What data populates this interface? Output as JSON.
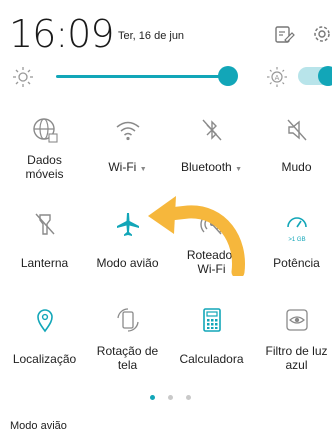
{
  "header": {
    "time": "16:09",
    "date": "Ter, 16 de jun"
  },
  "brightness": {
    "level": 0.94,
    "auto_enabled": true
  },
  "tiles": [
    {
      "label": "Dados\nmóveis",
      "icon": "globe-icon",
      "active": false
    },
    {
      "label": "Wi-Fi",
      "icon": "wifi-icon",
      "active": false,
      "has_menu": true
    },
    {
      "label": "Bluetooth",
      "icon": "bluetooth-off-icon",
      "active": false,
      "has_menu": true
    },
    {
      "label": "Mudo",
      "icon": "mute-icon",
      "active": false
    },
    {
      "label": "Lanterna",
      "icon": "flashlight-off-icon",
      "active": false
    },
    {
      "label": "Modo avião",
      "icon": "airplane-icon",
      "active": true
    },
    {
      "label": "Roteador\nWi-Fi",
      "icon": "hotspot-off-icon",
      "active": false
    },
    {
      "label": "Potência",
      "icon": "power-gauge-icon",
      "active": true,
      "sub": ">1 GB"
    },
    {
      "label": "Localização",
      "icon": "location-pin-icon",
      "active": true
    },
    {
      "label": "Rotação de\ntela",
      "icon": "rotation-icon",
      "active": false
    },
    {
      "label": "Calculadora",
      "icon": "calculator-icon",
      "active": true
    },
    {
      "label": "Filtro de luz\nazul",
      "icon": "eye-comfort-icon",
      "active": false
    }
  ],
  "pager": {
    "pages": 3,
    "current": 1
  },
  "footer": {
    "status_text": "Modo avião"
  },
  "colors": {
    "accent": "#12a6b8",
    "inactive_icon": "#8a8a8a",
    "arrow": "#f6b73c"
  }
}
